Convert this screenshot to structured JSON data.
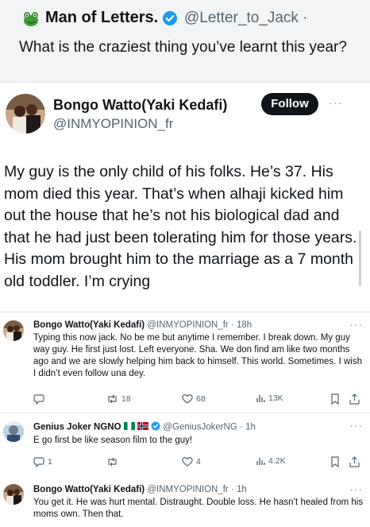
{
  "quoted": {
    "name": "Man of Letters.",
    "handle": "@Letter_to_Jack ·",
    "text": "What is the craziest thing you’ve learnt this year?"
  },
  "main_post": {
    "name": "Bongo Watto(Yaki Kedafi)",
    "handle": "@INMYOPINION_fr",
    "follow_label": "Follow",
    "more": "···",
    "text": "My guy is the only child of his folks. He’s 37. His mom died this year. That’s when alhaji kicked him out the house that he’s not his biological dad and that he had just been tolerating him for those years. His mom brought him to the marriage as a 7 month old toddler. I’m crying"
  },
  "replies": [
    {
      "name": "Bongo Watto(Yaki Kedafi)",
      "meta": "@INMYOPINION_fr · 18h",
      "more": "···",
      "text": "Typing this now jack. No be me but anytime I remember. I break down. My guy way guy. He first just lost. Left everyone. Sha. We don find am like two months ago and we are slowly helping him back to himself. This world. Sometimes. I wish I didn’t even follow una dey.",
      "stats": {
        "replies": "",
        "reposts": "18",
        "likes": "68",
        "views": "13K"
      }
    },
    {
      "name": "Genius Joker NGNO",
      "meta": "@GeniusJokerNG · 1h",
      "more": "···",
      "text": "E go first be like season film to the guy!",
      "stats": {
        "replies": "1",
        "reposts": "",
        "likes": "4",
        "views": "4.2K"
      }
    },
    {
      "name": "Bongo Watto(Yaki Kedafi)",
      "meta": "@INMYOPINION_fr · 1h",
      "more": "···",
      "text": "You get it. He was hurt mental. Distraught. Double loss. He hasn’t healed from his moms own. Then that."
    }
  ],
  "colors": {
    "verified": "#1d9bf0",
    "muted": "#536471",
    "follow_bg": "#0f1419"
  },
  "icons": [
    "frog-avatar",
    "verified-badge-icon",
    "reply-icon",
    "repost-icon",
    "like-icon",
    "views-icon",
    "bookmark-icon",
    "share-icon",
    "nigeria-flag-icon",
    "norway-flag-icon"
  ]
}
